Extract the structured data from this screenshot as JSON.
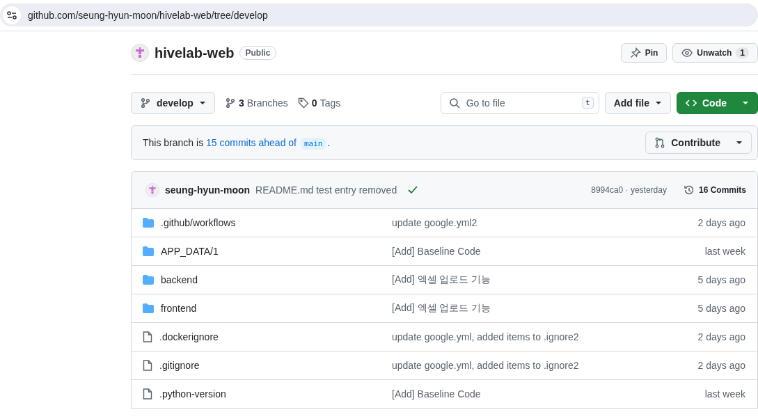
{
  "address_bar": {
    "url": "github.com/seung-hyun-moon/hivelab-web/tree/develop"
  },
  "repo": {
    "name": "hivelab-web",
    "visibility": "Public"
  },
  "repo_actions": [
    {
      "kind": "pin",
      "label": "Pin"
    },
    {
      "kind": "watch",
      "label": "Unwatch",
      "count": "1"
    }
  ],
  "toolbar": {
    "branch": "develop",
    "branches_count": "3",
    "branches_label": "Branches",
    "tags_count": "0",
    "tags_label": "Tags",
    "search": {
      "placeholder": "Go to file",
      "shortcut": "t"
    },
    "add_file": "Add file",
    "code": "Code"
  },
  "branch_banner": {
    "prefix": "This branch is",
    "link": "15 commits ahead of",
    "base": "main",
    "suffix": ".",
    "contribute": "Contribute"
  },
  "latest_commit": {
    "author": "seung-hyun-moon",
    "message": "README.md test entry removed",
    "passed": true,
    "hash": "8994ca0 · yesterday",
    "commits": "16 Commits"
  },
  "files": [
    {
      "kind": "folder",
      "name": ".github/workflows",
      "message": "update google.yml2",
      "time": "2 days ago"
    },
    {
      "kind": "folder",
      "name": "APP_DATA/1",
      "message": "[Add] Baseline Code",
      "time": "last week"
    },
    {
      "kind": "folder",
      "name": "backend",
      "message": "[Add] 엑셀 업로드 기능",
      "time": "5 days ago"
    },
    {
      "kind": "folder",
      "name": "frontend",
      "message": "[Add] 엑셀 업로드 기능",
      "time": "5 days ago"
    },
    {
      "kind": "file",
      "name": ".dockerignore",
      "message": "update google.yml, added items to .ignore2",
      "time": "2 days ago"
    },
    {
      "kind": "file",
      "name": ".gitignore",
      "message": "update google.yml, added items to .ignore2",
      "time": "2 days ago"
    },
    {
      "kind": "file",
      "name": ".python-version",
      "message": "[Add] Baseline Code",
      "time": "last week"
    }
  ]
}
